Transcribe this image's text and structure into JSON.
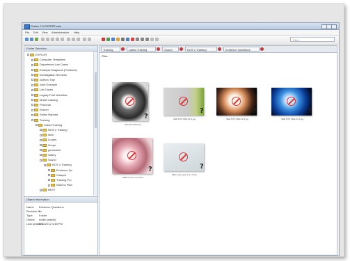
{
  "window": {
    "title": "Firefox 7.0 EXPERT.cam"
  },
  "menu": [
    "File",
    "Edit",
    "View",
    "Administration",
    "Help"
  ],
  "search": {
    "placeholder": "Filter..."
  },
  "folder_panel": {
    "title": "Folder Selection",
    "tree": [
      {
        "label": "EXPLOR",
        "level": 0
      },
      {
        "label": "Computer Templates",
        "level": 1
      },
      {
        "label": "Department Lab Cases",
        "level": 1
      },
      {
        "label": "Example Diagrams (Fishbone)",
        "level": 1
      },
      {
        "label": "Investigation Services",
        "level": 1
      },
      {
        "label": "Joelton Tray",
        "level": 1
      },
      {
        "label": "Joint Example",
        "level": 1
      },
      {
        "label": "Lab Cases",
        "level": 1
      },
      {
        "label": "Legacy Print Workflow",
        "level": 1
      },
      {
        "label": "Model Catalog",
        "level": 1
      },
      {
        "label": "Personal",
        "level": 1
      },
      {
        "label": "Search",
        "level": 1
      },
      {
        "label": "Select Reports",
        "level": 1
      },
      {
        "label": "Training",
        "level": 1
      },
      {
        "label": "Latest Training",
        "level": 2
      },
      {
        "label": "NCS V Training",
        "level": 3
      },
      {
        "label": "Idea",
        "level": 3
      },
      {
        "label": "Lunder",
        "level": 3
      },
      {
        "label": "Scope",
        "level": 3
      },
      {
        "label": "generated",
        "level": 3
      },
      {
        "label": "Safety",
        "level": 3
      },
      {
        "label": "Sound",
        "level": 3
      },
      {
        "label": "NCS V Training",
        "level": 4
      },
      {
        "label": "Evidence Qu",
        "level": 5
      },
      {
        "label": "Cataphr",
        "level": 5
      },
      {
        "label": "Training Pro",
        "level": 5
      },
      {
        "label": "Work to Plan",
        "level": 5
      },
      {
        "label": "BEST",
        "level": 3
      }
    ]
  },
  "object_info": {
    "title": "Object Information",
    "rows": [
      {
        "k": "Name",
        "v": "Evidence Questions"
      },
      {
        "k": "Revision No.",
        "v": "0"
      },
      {
        "k": "Type",
        "v": "Folder"
      },
      {
        "k": "Owner",
        "v": "eddie (admin)"
      },
      {
        "k": "Last Updated",
        "v": "6/12/2012 4:48 PM"
      }
    ]
  },
  "tabs": [
    "Training",
    "Latest Training",
    "Sound",
    "NCS V Training",
    "Evidence Questions"
  ],
  "files": {
    "label": "Files",
    "items": [
      {
        "caption": "IMG-NO 0037.jpg",
        "style": "dark"
      },
      {
        "caption": "SEE PICTURE-F2.2.jpg",
        "style": "gray"
      },
      {
        "caption": "SEE PICTURE-F2.3.jpg",
        "style": "bright"
      },
      {
        "caption": "SEE PICTURE-F4.4.jpg",
        "style": "blue"
      },
      {
        "caption": "SEE camera 1 as Print",
        "style": "pink"
      },
      {
        "caption": "SEE super gear 2.5 x Scan",
        "style": "light"
      }
    ]
  },
  "colors": {
    "accent": "#3b7bd0",
    "tab_close": "#c23a3a",
    "folder": "#e8c14a"
  }
}
